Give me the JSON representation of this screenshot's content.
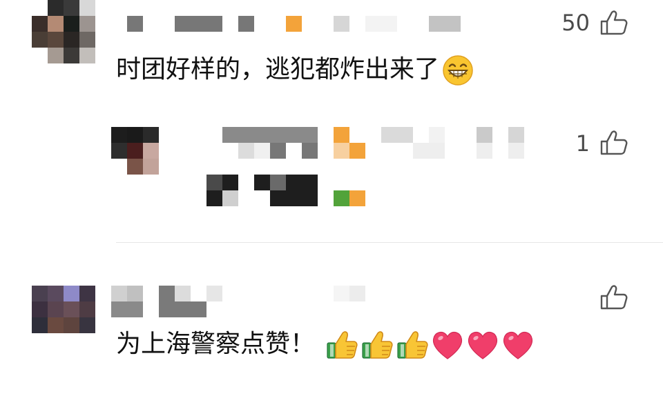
{
  "comments": [
    {
      "like_count": "50",
      "text": "时团好样的，逃犯都炸出来了",
      "emoji": "grinning-face-emoji"
    },
    {
      "like_count": "1",
      "text": ""
    },
    {
      "like_count": "",
      "text": "为上海警察点赞！",
      "emojis": [
        "thumbs-up-emoji",
        "thumbs-up-emoji",
        "thumbs-up-emoji",
        "heart-emoji",
        "heart-emoji",
        "heart-emoji"
      ]
    }
  ],
  "colors": {
    "text": "#111111",
    "meta": "#4a4a4a",
    "icon": "#555555",
    "heart": "#f03e6a",
    "divider": "#e6e6e6"
  }
}
